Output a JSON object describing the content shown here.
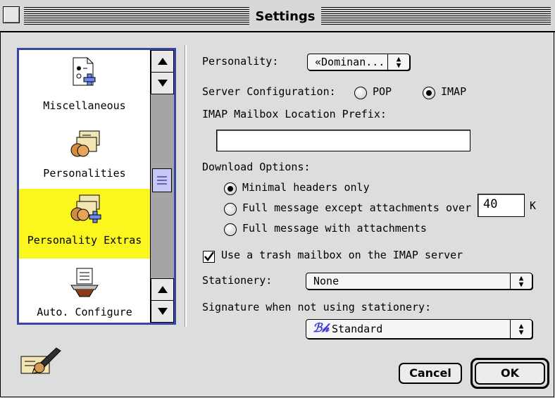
{
  "window": {
    "title": "Settings"
  },
  "sidebar": {
    "items": [
      {
        "label": "Miscellaneous",
        "icon": "miscellaneous-icon",
        "selected": false
      },
      {
        "label": "Personalities",
        "icon": "personalities-icon",
        "selected": false
      },
      {
        "label": "Personality Extras",
        "icon": "personality-extras-icon",
        "selected": true
      },
      {
        "label": "Auto. Configure",
        "icon": "auto-configure-icon",
        "selected": false
      }
    ]
  },
  "form": {
    "personality_label": "Personality:",
    "personality_value": "«Dominan...",
    "server_config_label": "Server Configuration:",
    "server_options": [
      {
        "label": "POP",
        "selected": false
      },
      {
        "label": "IMAP",
        "selected": true
      }
    ],
    "prefix_label": "IMAP Mailbox Location Prefix:",
    "prefix_value": "",
    "download_label": "Download Options:",
    "download_options": [
      {
        "label": "Minimal headers only",
        "selected": true
      },
      {
        "label": "Full message except attachments over",
        "selected": false
      },
      {
        "label": "Full message with attachments",
        "selected": false
      }
    ],
    "attachment_size_value": "40",
    "attachment_size_unit": "K",
    "trash_label": "Use a trash mailbox on the IMAP server",
    "trash_checked": true,
    "stationery_label": "Stationery:",
    "stationery_value": "None",
    "signature_label": "Signature when not using stationery:",
    "signature_value": "Standard"
  },
  "buttons": {
    "cancel": "Cancel",
    "ok": "OK"
  },
  "colors": {
    "selection": "#fbf61e",
    "list_border": "#3846a8",
    "background": "#dddddd"
  }
}
